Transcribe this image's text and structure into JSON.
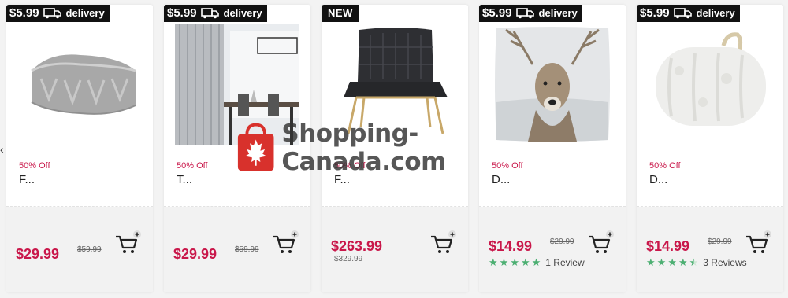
{
  "colors": {
    "sale": "#c9174a",
    "star": "#4caf72",
    "badge_bg": "#111111"
  },
  "products": [
    {
      "badge": "$5.99",
      "badge_suffix": "delivery",
      "discount": "50% Off",
      "name": "F...",
      "price": "$29.99",
      "old_price": "$59.99",
      "image_icon": "knit-throw-blanket-image"
    },
    {
      "badge": "$5.99",
      "badge_suffix": "delivery",
      "discount": "50% Off",
      "name": "T...",
      "price": "$29.99",
      "old_price": "$59.99",
      "image_icon": "curtain-dining-room-image"
    },
    {
      "badge": "NEW",
      "badge_suffix": "",
      "discount": "50% Off",
      "name": "F...",
      "price": "$263.99",
      "old_price": "$329.99",
      "image_icon": "tufted-accent-chair-image"
    },
    {
      "badge": "$5.99",
      "badge_suffix": "delivery",
      "discount": "50% Off",
      "name": "D...",
      "price": "$14.99",
      "old_price": "$29.99",
      "rating": 5,
      "reviews": "1 Review",
      "image_icon": "deer-cushion-image"
    },
    {
      "badge": "$5.99",
      "badge_suffix": "delivery",
      "discount": "50% Off",
      "name": "D...",
      "price": "$14.99",
      "old_price": "$29.99",
      "rating": 4.5,
      "reviews": "3 Reviews",
      "image_icon": "sherpa-throw-roll-image"
    }
  ],
  "watermark": {
    "text": "Shopping-Canada.com"
  }
}
